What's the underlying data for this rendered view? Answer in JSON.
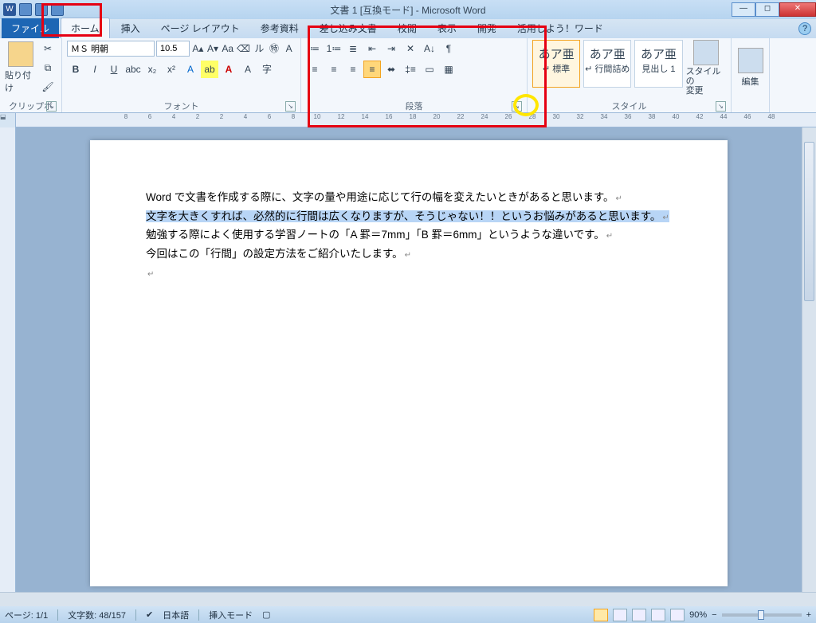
{
  "title": "文書 1 [互換モード] - Microsoft Word",
  "tabs": {
    "file": "ファイル",
    "items": [
      "ホーム",
      "挿入",
      "ページ レイアウト",
      "参考資料",
      "差し込み文書",
      "校閲",
      "表示",
      "開発",
      "活用しよう！ワード"
    ],
    "active": 0
  },
  "ribbon": {
    "clipboard": {
      "label": "クリップボード",
      "paste": "貼り付け"
    },
    "font": {
      "label": "フォント",
      "name": "ＭＳ 明朝",
      "size": "10.5"
    },
    "paragraph": {
      "label": "段落"
    },
    "styles": {
      "label": "スタイル",
      "items": [
        {
          "sample": "あア亜",
          "name": "↵ 標準"
        },
        {
          "sample": "あア亜",
          "name": "↵ 行間詰め"
        },
        {
          "sample": "あア亜",
          "name": "見出し 1"
        }
      ],
      "change": "スタイルの\n変更"
    },
    "edit": {
      "label": "編集"
    }
  },
  "ruler": {
    "marks": [
      8,
      6,
      4,
      2,
      2,
      4,
      6,
      8,
      10,
      12,
      14,
      16,
      18,
      20,
      22,
      24,
      26,
      28,
      30,
      32,
      34,
      36,
      38,
      40,
      42,
      44,
      46,
      48
    ]
  },
  "document": {
    "p1": "Word で文書を作成する際に、文字の量や用途に応じて行の幅を変えたいときがあると思います。",
    "p2": "文字を大きくすれば、必然的に行間は広くなりますが、そうじゃない！！というお悩みがあると思います。",
    "p3": "勉強する際によく使用する学習ノートの「A 罫＝7mm」「B 罫＝6mm」というような違いです。",
    "p4": "今回はこの「行間」の設定方法をご紹介いたします。"
  },
  "status": {
    "page": "ページ: 1/1",
    "words": "文字数: 48/157",
    "lang": "日本語",
    "mode": "挿入モード",
    "zoom": "90%"
  }
}
